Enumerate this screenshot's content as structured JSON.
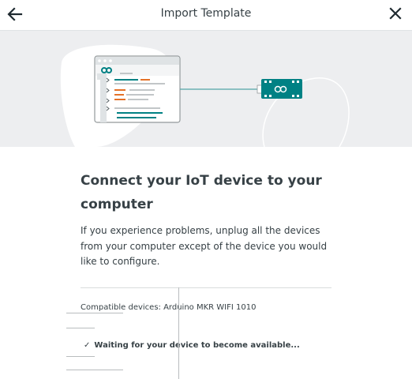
{
  "header": {
    "title": "Import Template",
    "back_icon": "arrow-left-icon",
    "close_icon": "close-icon"
  },
  "hero": {
    "illustration": "editor-connected-to-board",
    "colors": {
      "teal": "#008184",
      "orange": "#e47128",
      "panel": "#edeef0"
    }
  },
  "main": {
    "heading": "Connect your IoT device to your computer",
    "description": "If you experience problems, unplug all the devices from your computer except of the device you would like to configure.",
    "compatible": "Compatible devices: Arduino MKR WIFI 1010",
    "waiting": "Waiting for your device to become available...",
    "check_glyph": "✓"
  }
}
